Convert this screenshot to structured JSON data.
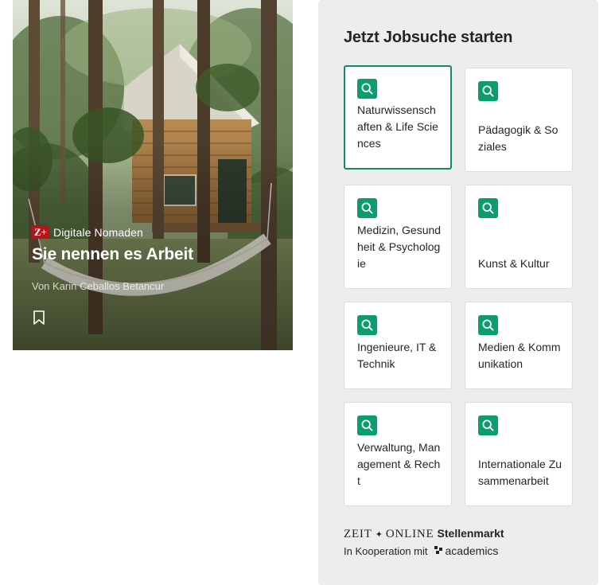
{
  "teaser": {
    "kicker": "Digitale Nomaden",
    "zplus_badge": "Z+",
    "title": "Sie nennen es Arbeit",
    "byline": "Von Karin Ceballos Betancur",
    "icons": {
      "bookmark": "bookmark-icon",
      "badge": "zplus-icon"
    },
    "colors": {
      "badge": "#b5161b"
    }
  },
  "jobs": {
    "heading": "Jetzt Jobsuche starten",
    "tiles": [
      {
        "label": "Naturwissenschaften & Life Sciences",
        "active": true
      },
      {
        "label": "Pädagogik & Soziales",
        "active": false
      },
      {
        "label": "Medizin, Gesundheit & Psychologie",
        "active": false
      },
      {
        "label": "Kunst & Kultur",
        "active": false
      },
      {
        "label": "Ingenieure, IT & Technik",
        "active": false
      },
      {
        "label": "Medien & Kommunikation",
        "active": false
      },
      {
        "label": "Verwaltung, Management & Recht",
        "active": false
      },
      {
        "label": "Internationale Zusammenarbeit",
        "active": false
      }
    ],
    "icon": "search-icon",
    "colors": {
      "accent": "#0b9d6d",
      "active_border": "#0f8a6a",
      "panel_bg": "#ededed"
    }
  },
  "footer": {
    "zeit": "ZEIT",
    "online": "ONLINE",
    "stellenmarkt": "Stellenmarkt",
    "kooperation": "In Kooperation mit",
    "partner": "academics"
  }
}
